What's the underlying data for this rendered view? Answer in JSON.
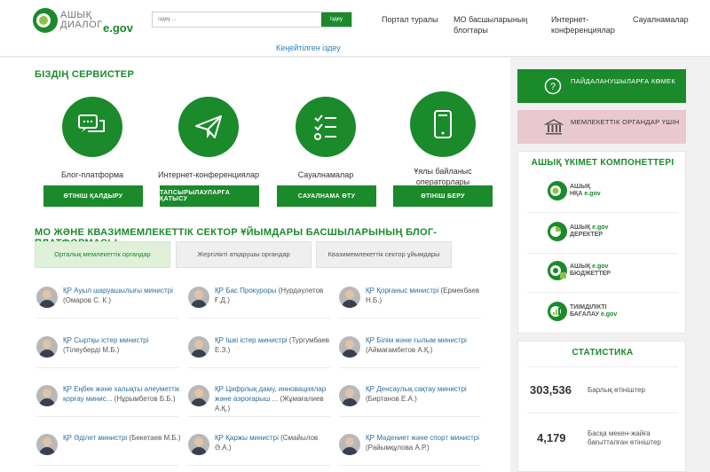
{
  "header": {
    "logo": {
      "line1": "АШЫҚ",
      "line2": "ДИАЛОГ",
      "gov": "e.gov"
    },
    "search": {
      "placeholder": "Іздеу ...",
      "button": "Іздеу"
    },
    "advanced_search": "Кеңейтілген іздеу",
    "nav": [
      {
        "label": "Портал туралы"
      },
      {
        "label": "МО басшыларының блогтары"
      },
      {
        "label": "Интернет-конференциялар"
      },
      {
        "label": "Сауалнамалар"
      }
    ]
  },
  "services": {
    "title": "БІЗДІҢ СЕРВИСТЕР",
    "items": [
      {
        "name": "Блог-платформа",
        "icon": "chat-bubbles-icon",
        "button": "ӨТІНІШ ҚАЛДЫРУ"
      },
      {
        "name": "Интернет-конференциялар",
        "icon": "paper-plane-icon",
        "button": "ТАПСЫРЫЛАУЛАРҒА ҚАТЫСУ"
      },
      {
        "name": "Сауалнамалар",
        "icon": "checklist-icon",
        "button": "САУАЛНАМА ӨТУ"
      },
      {
        "name": "Ұялы байланыс операторлары",
        "icon": "mobile-phone-icon",
        "button": "ӨТІНІШ БЕРУ"
      }
    ]
  },
  "blogs": {
    "title": "МО ЖӘНЕ КВАЗИМЕМЛЕКЕТТІК СЕКТОР ҰЙЫМДАРЫ БАСШЫЛАРЫНЫҢ БЛОГ-ПЛАТФОРМАСЫ",
    "tabs": [
      {
        "label": "Орталық мемлекеттік органдар",
        "active": true
      },
      {
        "label": "Жергілікті атқарушы органдар",
        "active": false
      },
      {
        "label": "Квазимемлекеттік сектор ұйымдары",
        "active": false
      }
    ],
    "items": [
      {
        "title": "ҚР Ауыл шаруашылығы министрі",
        "author": "(Омаров С. К.)"
      },
      {
        "title": "ҚР Бас Прокуроры",
        "author": "(Нурдәулетов Ғ.Д.)"
      },
      {
        "title": "ҚР Қорғаныс министрі",
        "author": "(Ермекбаев Н.Б.)"
      },
      {
        "title": "ҚР Сыртқы істер министрі",
        "author": "(Тілеуберді М.Б.)"
      },
      {
        "title": "ҚР Ішкі істер министрі",
        "author": "(Тургумбаев Е.З.)"
      },
      {
        "title": "ҚР Білім және ғылым министрі",
        "author": "(Аймағамбетов А.Қ.)"
      },
      {
        "title": "ҚР Еңбек және халықты әлеуметтік қорғау минис...",
        "author": "(Нұрымбетов Б.Б.)"
      },
      {
        "title": "ҚР Цифрлық даму, инновациялар және аэроғарыш ...",
        "author": "(Жұмағалиев А.Қ.)"
      },
      {
        "title": "ҚР Денсаулық сақтау министрі",
        "author": "(Биртанов Е.А.)"
      },
      {
        "title": "ҚР Әділет министрі",
        "author": "(Бекетаев М.Б.)"
      },
      {
        "title": "ҚР Қаржы министрі",
        "author": "(Смайылов Ә.А.)"
      },
      {
        "title": "ҚР Мәдениет және спорт министрі",
        "author": "(Райымқұлова А.Р.)"
      }
    ]
  },
  "sidebar": {
    "user_help": "ПАЙДАЛАНУШЫЛАРҒА КӨМЕК",
    "gov_bodies": "МЕМЛЕКЕТТІК ОРГАНДАР ҮШІН",
    "components_title": "АШЫҚ ҮКІМЕТ КОМПОНЕТТЕРІ",
    "components": [
      {
        "line1": "АШЫҚ",
        "line2": "НҚА",
        "gov": "e.gov"
      },
      {
        "line1": "АШЫҚ",
        "line2": "ДЕРЕКТЕР",
        "gov": "e.gov"
      },
      {
        "line1": "АШЫҚ",
        "line2": "БЮДЖЕТТЕР",
        "gov": "e.gov"
      },
      {
        "line1": "ТИІМДІЛІКТІ",
        "line2": "БАҒАЛАУ",
        "gov": "e.gov"
      }
    ],
    "stats_title": "СТАТИСТИКА",
    "stats": [
      {
        "value": "303,536",
        "label": "Барлық өтініштер"
      },
      {
        "value": "4,179",
        "label": "Басқа мекен-жайға бағытталған өтініштер"
      }
    ]
  },
  "colors": {
    "brand_green": "#1a8a2b",
    "pink": "#e9c8cf",
    "link_blue": "#2f6f9e"
  }
}
